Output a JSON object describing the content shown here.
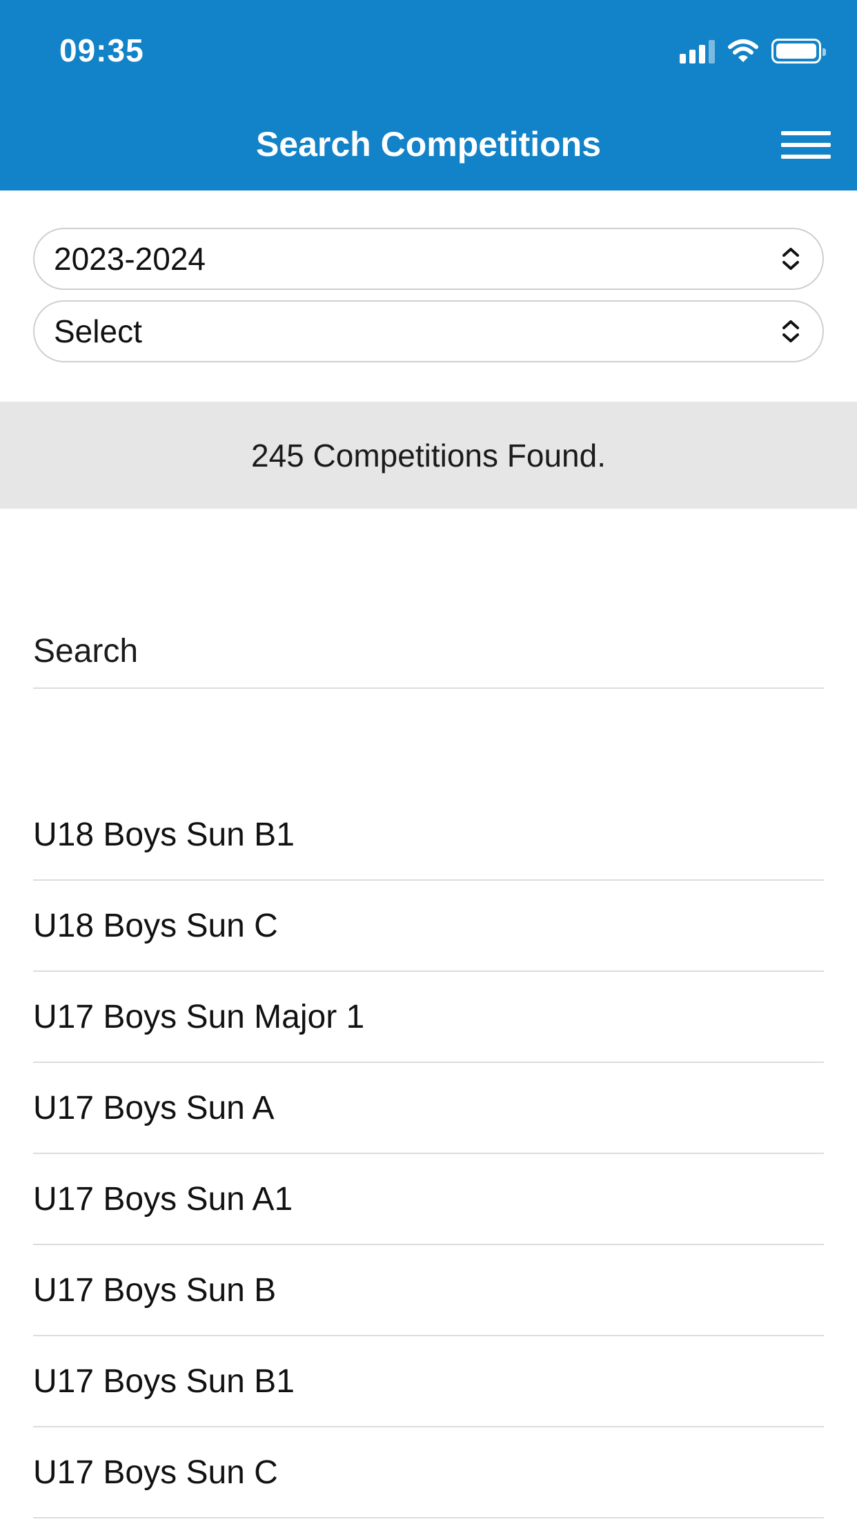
{
  "status_bar": {
    "time": "09:35"
  },
  "header": {
    "title": "Search Competitions"
  },
  "filters": {
    "season": "2023-2024",
    "competition_type": "Select"
  },
  "results": {
    "summary": "245 Competitions Found."
  },
  "search": {
    "placeholder": "Search"
  },
  "competitions": [
    {
      "name": "U18 Boys Sun B1"
    },
    {
      "name": "U18 Boys Sun C"
    },
    {
      "name": "U17 Boys Sun Major 1"
    },
    {
      "name": "U17 Boys Sun A"
    },
    {
      "name": "U17 Boys Sun A1"
    },
    {
      "name": "U17 Boys Sun B"
    },
    {
      "name": "U17 Boys Sun B1"
    },
    {
      "name": "U17 Boys Sun C"
    }
  ],
  "theme": {
    "header_color": "#1283c8",
    "results_bar_color": "#e6e6e6"
  }
}
